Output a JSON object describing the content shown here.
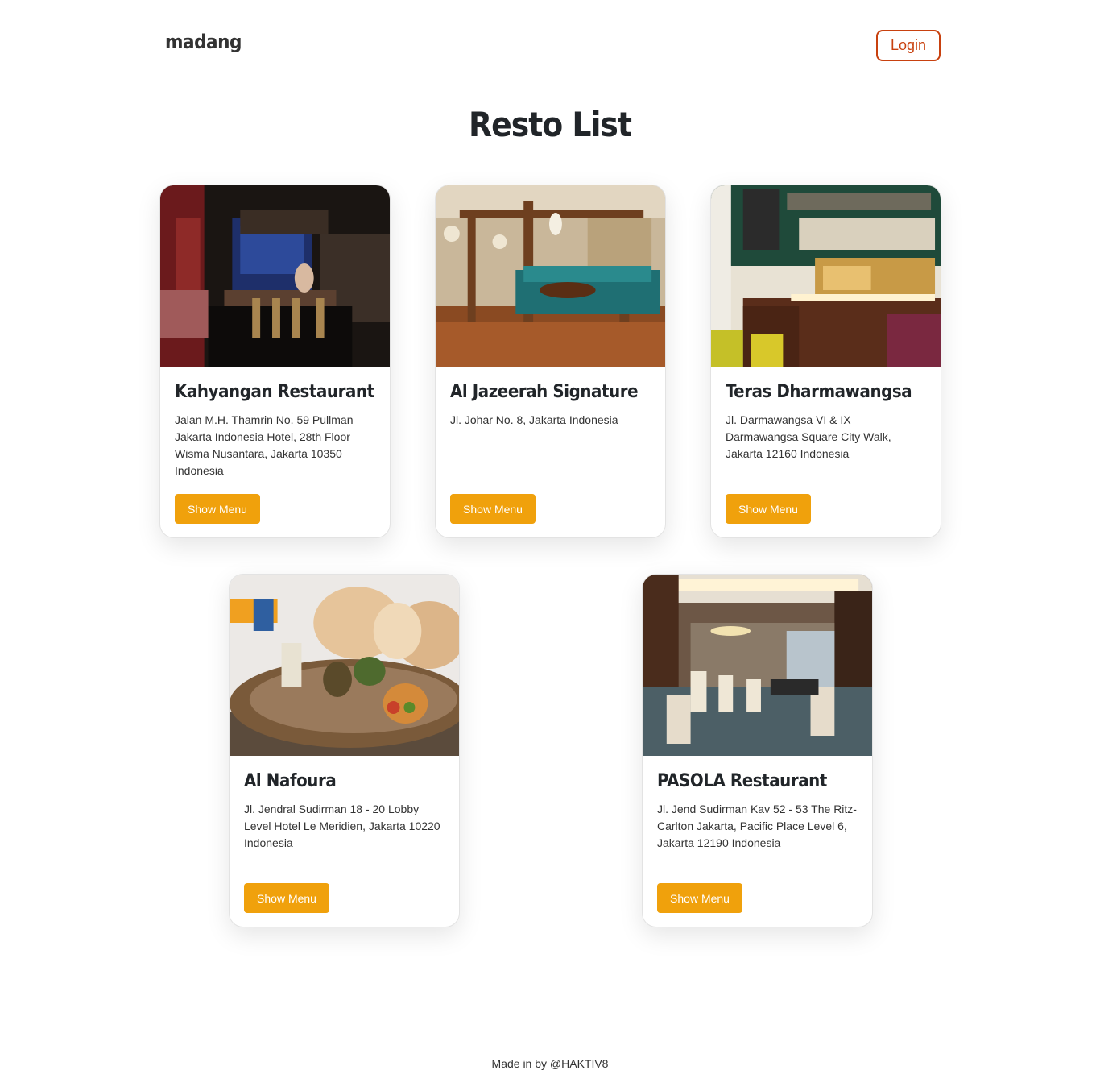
{
  "navbar": {
    "brand": "madang",
    "login_label": "Login"
  },
  "page": {
    "title": "Resto List"
  },
  "restaurants": [
    {
      "name": "Kahyangan Restaurant",
      "address": "Jalan M.H. Thamrin No. 59 Pullman Jakarta Indonesia Hotel, 28th Floor Wisma Nusantara, Jakarta 10350 Indonesia",
      "button_label": "Show Menu"
    },
    {
      "name": "Al Jazeerah Signature",
      "address": "Jl. Johar No. 8, Jakarta Indonesia",
      "button_label": "Show Menu"
    },
    {
      "name": "Teras Dharmawangsa",
      "address": "Jl. Darmawangsa VI & IX Darmawangsa Square City Walk, Jakarta 12160 Indonesia",
      "button_label": "Show Menu"
    },
    {
      "name": "Al Nafoura",
      "address": "Jl. Jendral Sudirman 18 - 20 Lobby Level Hotel Le Meridien, Jakarta 10220 Indonesia",
      "button_label": "Show Menu"
    },
    {
      "name": "PASOLA Restaurant",
      "address": "Jl. Jend Sudirman Kav 52 - 53 The Ritz-Carlton Jakarta, Pacific Place Level 6, Jakarta 12190 Indonesia",
      "button_label": "Show Menu"
    }
  ],
  "footer": {
    "text": "Made in by @HAKTIV8"
  },
  "colors": {
    "accent": "#f0a10c",
    "login_border": "#c8410f"
  }
}
